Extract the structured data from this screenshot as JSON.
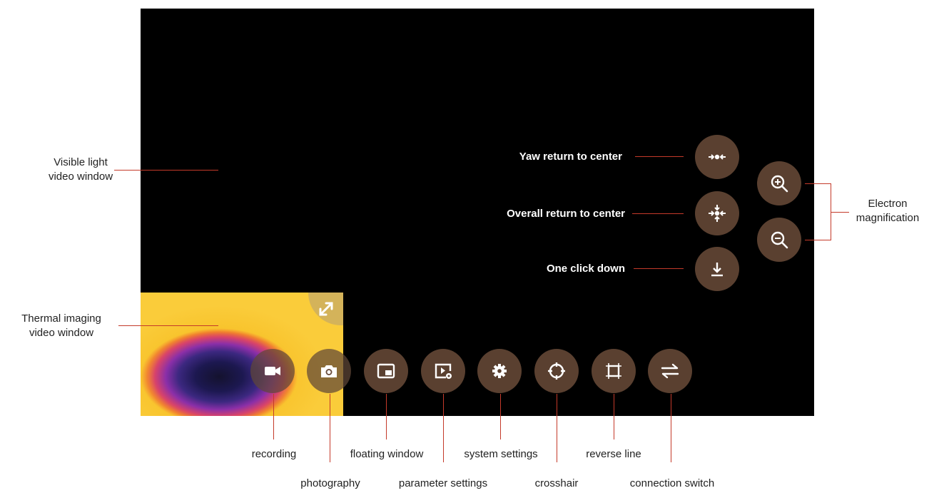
{
  "annotations": {
    "visible_light": [
      "Visible light",
      "video window"
    ],
    "thermal": [
      "Thermal imaging",
      "video window"
    ],
    "electron": [
      "Electron",
      "magnification"
    ],
    "yaw_center": "Yaw return to center",
    "overall_center": "Overall return to center",
    "one_click_down": "One click down",
    "recording": "recording",
    "photography": "photography",
    "floating_window": "floating window",
    "parameter_settings": "parameter settings",
    "system_settings": "system settings",
    "crosshair": "crosshair",
    "reverse_line": "reverse line",
    "connection_switch": "connection switch"
  },
  "colors": {
    "button": "#5a4030",
    "leader_line": "#c43a2a",
    "screen": "#000000"
  },
  "icons": [
    "record-icon",
    "camera-icon",
    "floating-window-icon",
    "parameter-settings-icon",
    "gear-icon",
    "crosshair-icon",
    "reverse-line-icon",
    "connection-switch-icon",
    "yaw-center-icon",
    "overall-center-icon",
    "one-click-down-icon",
    "zoom-in-icon",
    "zoom-out-icon",
    "expand-icon"
  ]
}
